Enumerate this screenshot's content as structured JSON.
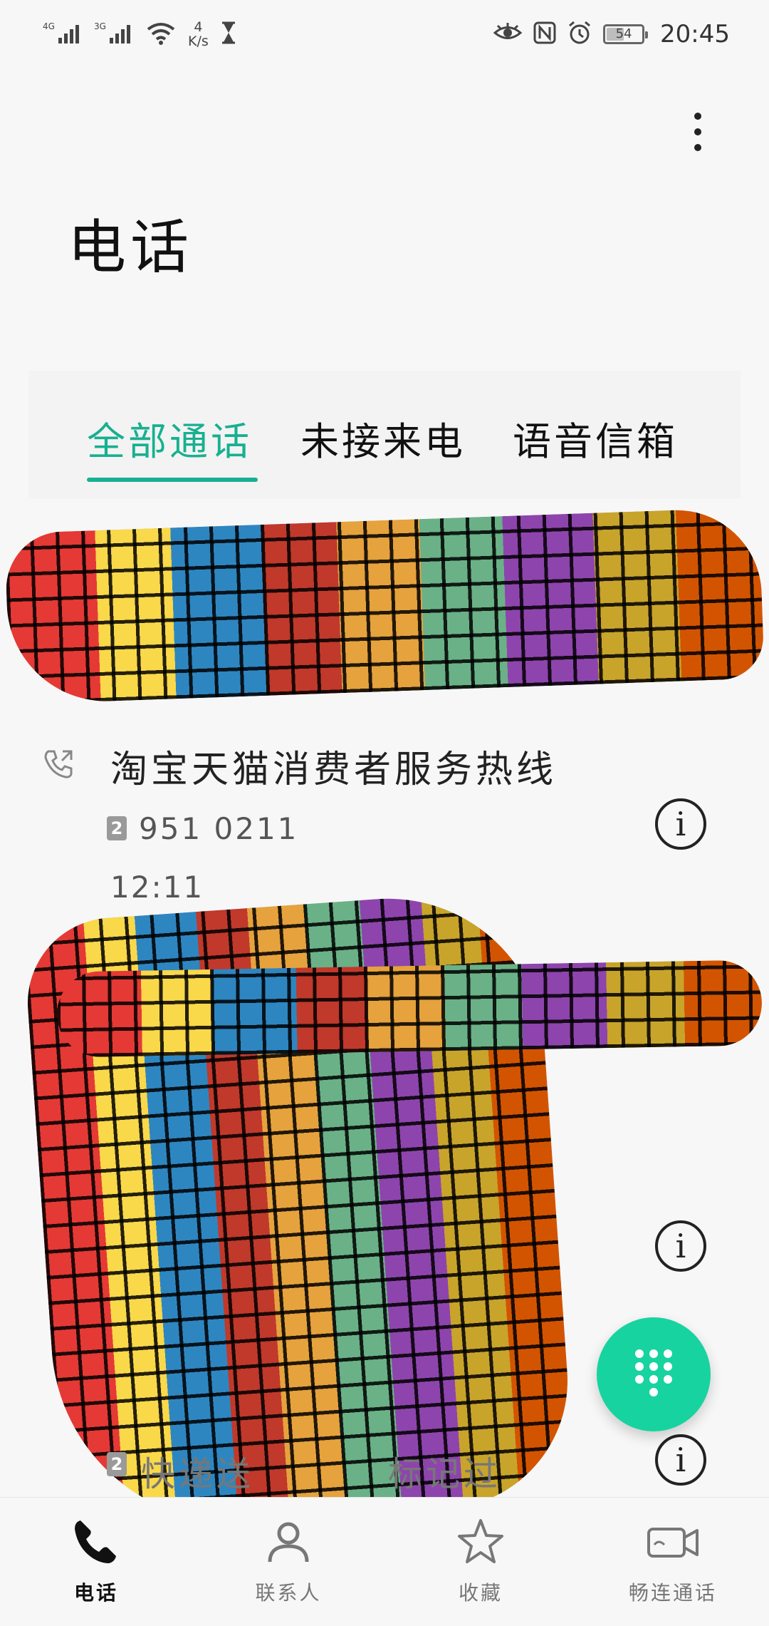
{
  "status_bar": {
    "signal1_label": "4G",
    "signal2_label": "3G",
    "speed_value": "4",
    "speed_unit": "K/s",
    "battery_level": "54",
    "battery_fraction": 0.54,
    "time": "20:45"
  },
  "page": {
    "title": "电话"
  },
  "tabs": [
    {
      "label": "全部通话",
      "active": true
    },
    {
      "label": "未接来电",
      "active": false
    },
    {
      "label": "语音信箱",
      "active": false
    }
  ],
  "calls": [
    {
      "name": "淘宝天猫消费者服务热线",
      "sim": "2",
      "number": "951 0211",
      "time": "12:11",
      "icon": "outgoing-call-icon"
    }
  ],
  "partial_visible": {
    "sim": "2",
    "text": "快递送",
    "text_tail": "标记过"
  },
  "bottom_nav": [
    {
      "label": "电话",
      "icon": "phone-icon",
      "active": true
    },
    {
      "label": "联系人",
      "icon": "contacts-icon",
      "active": false
    },
    {
      "label": "收藏",
      "icon": "star-icon",
      "active": false
    },
    {
      "label": "畅连通话",
      "icon": "video-call-icon",
      "active": false
    }
  ],
  "colors": {
    "accent": "#17b090",
    "fab": "#17d3a0"
  }
}
